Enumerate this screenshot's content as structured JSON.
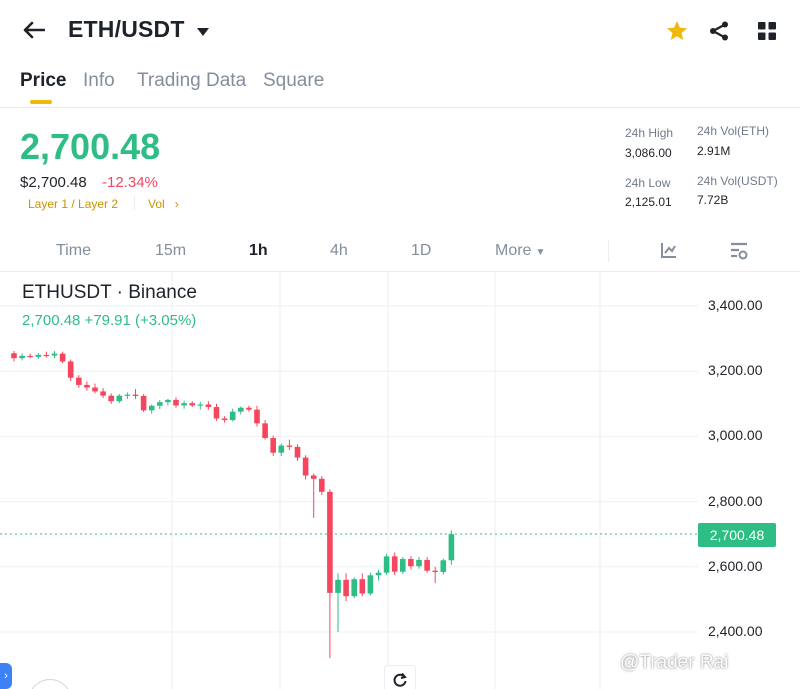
{
  "header": {
    "pair": "ETH/USDT",
    "icons": [
      "back-arrow-icon",
      "caret-down-icon",
      "star-icon",
      "share-icon",
      "grid-icon"
    ],
    "star_color": "#f0b90b"
  },
  "tabs": [
    {
      "label": "Price",
      "active": true
    },
    {
      "label": "Info"
    },
    {
      "label": "Trading Data"
    },
    {
      "label": "Square"
    }
  ],
  "price": {
    "last": "2,700.48",
    "usd": "$2,700.48",
    "change": "-12.34%",
    "tag1": "Layer 1 / Layer 2",
    "tag2": "Vol",
    "up_color": "#2ebd85",
    "down_color": "#f6465d"
  },
  "stats": {
    "high_label": "24h High",
    "high_value": "3,086.00",
    "low_label": "24h Low",
    "low_value": "2,125.01",
    "vol_eth_label": "24h Vol(ETH)",
    "vol_eth_value": "2.91M",
    "vol_usdt_label": "24h Vol(USDT)",
    "vol_usdt_value": "7.72B"
  },
  "intervals": {
    "items": [
      "Time",
      "15m",
      "1h",
      "4h",
      "1D",
      "More"
    ],
    "active": "1h",
    "icons": [
      "indicator-icon",
      "settings-icon"
    ]
  },
  "chart": {
    "title": "ETHUSDT · Binance",
    "subtitle": "2,700.48  +79.91 (+3.05%)",
    "last_price_label": "2,700.48",
    "watermark": "@Trader Rai"
  },
  "chart_data": {
    "type": "candlestick",
    "ylim": [
      2320,
      3480
    ],
    "yticks": [
      "3,400.00",
      "3,200.00",
      "3,000.00",
      "2,800.00",
      "2,600.00",
      "2,400.00"
    ],
    "ytick_values": [
      3400,
      3200,
      3000,
      2800,
      2600,
      2400
    ],
    "last_price": 2700.48,
    "up_color": "#2ebd85",
    "down_color": "#f6465d",
    "candles": [
      [
        3255,
        3262,
        3230,
        3240
      ],
      [
        3240,
        3255,
        3233,
        3247
      ],
      [
        3247,
        3254,
        3240,
        3244
      ],
      [
        3244,
        3256,
        3238,
        3250
      ],
      [
        3250,
        3260,
        3242,
        3248
      ],
      [
        3248,
        3262,
        3240,
        3254
      ],
      [
        3254,
        3260,
        3225,
        3230
      ],
      [
        3230,
        3236,
        3170,
        3180
      ],
      [
        3180,
        3188,
        3150,
        3158
      ],
      [
        3158,
        3168,
        3140,
        3150
      ],
      [
        3150,
        3162,
        3132,
        3138
      ],
      [
        3138,
        3148,
        3118,
        3125
      ],
      [
        3125,
        3132,
        3100,
        3108
      ],
      [
        3108,
        3130,
        3102,
        3125
      ],
      [
        3125,
        3135,
        3115,
        3128
      ],
      [
        3128,
        3145,
        3115,
        3124
      ],
      [
        3124,
        3130,
        3075,
        3080
      ],
      [
        3080,
        3098,
        3070,
        3094
      ],
      [
        3094,
        3112,
        3084,
        3105
      ],
      [
        3105,
        3115,
        3095,
        3112
      ],
      [
        3112,
        3120,
        3088,
        3095
      ],
      [
        3095,
        3110,
        3085,
        3102
      ],
      [
        3102,
        3108,
        3090,
        3095
      ],
      [
        3095,
        3106,
        3082,
        3098
      ],
      [
        3098,
        3108,
        3082,
        3090
      ],
      [
        3090,
        3100,
        3048,
        3055
      ],
      [
        3055,
        3062,
        3042,
        3050
      ],
      [
        3050,
        3085,
        3046,
        3076
      ],
      [
        3076,
        3092,
        3068,
        3088
      ],
      [
        3088,
        3094,
        3076,
        3082
      ],
      [
        3082,
        3094,
        3030,
        3040
      ],
      [
        3040,
        3050,
        2990,
        2995
      ],
      [
        2995,
        3002,
        2940,
        2950
      ],
      [
        2950,
        2978,
        2940,
        2972
      ],
      [
        2972,
        2990,
        2958,
        2968
      ],
      [
        2968,
        2976,
        2925,
        2935
      ],
      [
        2935,
        2942,
        2868,
        2880
      ],
      [
        2880,
        2886,
        2750,
        2870
      ],
      [
        2870,
        2878,
        2820,
        2830
      ],
      [
        2830,
        2838,
        2320,
        2520
      ],
      [
        2520,
        2580,
        2400,
        2560
      ],
      [
        2560,
        2580,
        2495,
        2510
      ],
      [
        2510,
        2568,
        2504,
        2562
      ],
      [
        2562,
        2580,
        2510,
        2518
      ],
      [
        2518,
        2582,
        2512,
        2574
      ],
      [
        2574,
        2590,
        2558,
        2582
      ],
      [
        2582,
        2640,
        2575,
        2632
      ],
      [
        2632,
        2644,
        2575,
        2585
      ],
      [
        2585,
        2630,
        2578,
        2624
      ],
      [
        2624,
        2632,
        2592,
        2602
      ],
      [
        2602,
        2630,
        2594,
        2621
      ],
      [
        2621,
        2630,
        2582,
        2588
      ],
      [
        2588,
        2600,
        2550,
        2584
      ],
      [
        2584,
        2625,
        2576,
        2620
      ],
      [
        2620,
        2712,
        2606,
        2700
      ]
    ]
  }
}
